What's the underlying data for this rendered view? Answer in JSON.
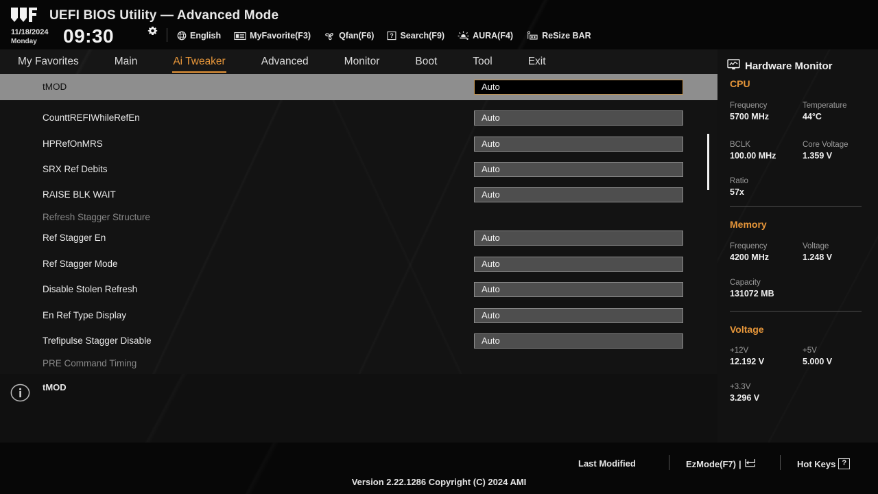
{
  "header": {
    "logo_icon": "tuf-logo",
    "title": "UEFI BIOS Utility — Advanced Mode",
    "date": "11/18/2024",
    "weekday": "Monday",
    "time": "09:30",
    "gear_icon": "gear-icon",
    "tools": [
      {
        "label": "English",
        "icon": "globe-icon"
      },
      {
        "label": "MyFavorite(F3)",
        "icon": "favorite-list-icon"
      },
      {
        "label": "Qfan(F6)",
        "icon": "qfan-icon"
      },
      {
        "label": "Search(F9)",
        "icon": "search-question-icon"
      },
      {
        "label": "AURA(F4)",
        "icon": "aura-light-icon"
      },
      {
        "label": "ReSize BAR",
        "icon": "resize-bar-icon"
      }
    ]
  },
  "nav": {
    "tabs": [
      {
        "label": "My Favorites",
        "active": false
      },
      {
        "label": "Main",
        "active": false
      },
      {
        "label": "Ai Tweaker",
        "active": true
      },
      {
        "label": "Advanced",
        "active": false
      },
      {
        "label": "Monitor",
        "active": false
      },
      {
        "label": "Boot",
        "active": false
      },
      {
        "label": "Tool",
        "active": false
      },
      {
        "label": "Exit",
        "active": false
      }
    ],
    "accent_color": "#e8973a"
  },
  "settings": {
    "rows": [
      {
        "label": "tMOD",
        "value": "Auto",
        "type": "field",
        "selected": true
      },
      {
        "label": "CounttREFIWhileRefEn",
        "value": "Auto",
        "type": "field",
        "selected": false
      },
      {
        "label": "HPRefOnMRS",
        "value": "Auto",
        "type": "field",
        "selected": false
      },
      {
        "label": "SRX Ref Debits",
        "value": "Auto",
        "type": "field",
        "selected": false
      },
      {
        "label": "RAISE BLK WAIT",
        "value": "Auto",
        "type": "field",
        "selected": false
      },
      {
        "label": "Refresh Stagger Structure",
        "value": "",
        "type": "section",
        "selected": false
      },
      {
        "label": "Ref Stagger En",
        "value": "Auto",
        "type": "field",
        "selected": false
      },
      {
        "label": "Ref Stagger Mode",
        "value": "Auto",
        "type": "field",
        "selected": false
      },
      {
        "label": "Disable Stolen Refresh",
        "value": "Auto",
        "type": "field",
        "selected": false
      },
      {
        "label": "En Ref Type Display",
        "value": "Auto",
        "type": "field",
        "selected": false
      },
      {
        "label": "Trefipulse Stagger Disable",
        "value": "Auto",
        "type": "field",
        "selected": false
      },
      {
        "label": "PRE Command Timing",
        "value": "",
        "type": "section",
        "selected": false
      }
    ]
  },
  "help": {
    "icon": "info-icon",
    "text": "tMOD"
  },
  "hardware_monitor": {
    "title": "Hardware Monitor",
    "icon": "monitor-icon",
    "sections": [
      {
        "name": "CPU",
        "items": [
          {
            "key": "Frequency",
            "value": "5700 MHz"
          },
          {
            "key": "Temperature",
            "value": "44°C"
          },
          {
            "key": "BCLK",
            "value": "100.00 MHz"
          },
          {
            "key": "Core Voltage",
            "value": "1.359 V"
          },
          {
            "key": "Ratio",
            "value": "57x"
          }
        ]
      },
      {
        "name": "Memory",
        "items": [
          {
            "key": "Frequency",
            "value": "4200 MHz"
          },
          {
            "key": "Voltage",
            "value": "1.248 V"
          },
          {
            "key": "Capacity",
            "value": "131072 MB"
          }
        ]
      },
      {
        "name": "Voltage",
        "items": [
          {
            "key": "+12V",
            "value": "12.192 V"
          },
          {
            "key": "+5V",
            "value": "5.000 V"
          },
          {
            "key": "+3.3V",
            "value": "3.296 V"
          }
        ]
      }
    ]
  },
  "footer": {
    "last_modified": "Last Modified",
    "ezmode": "EzMode(F7)",
    "ezmode_suffix": "|",
    "hotkeys": "Hot Keys",
    "hotkeys_badge": "?",
    "version": "Version 2.22.1286 Copyright (C) 2024 AMI"
  }
}
